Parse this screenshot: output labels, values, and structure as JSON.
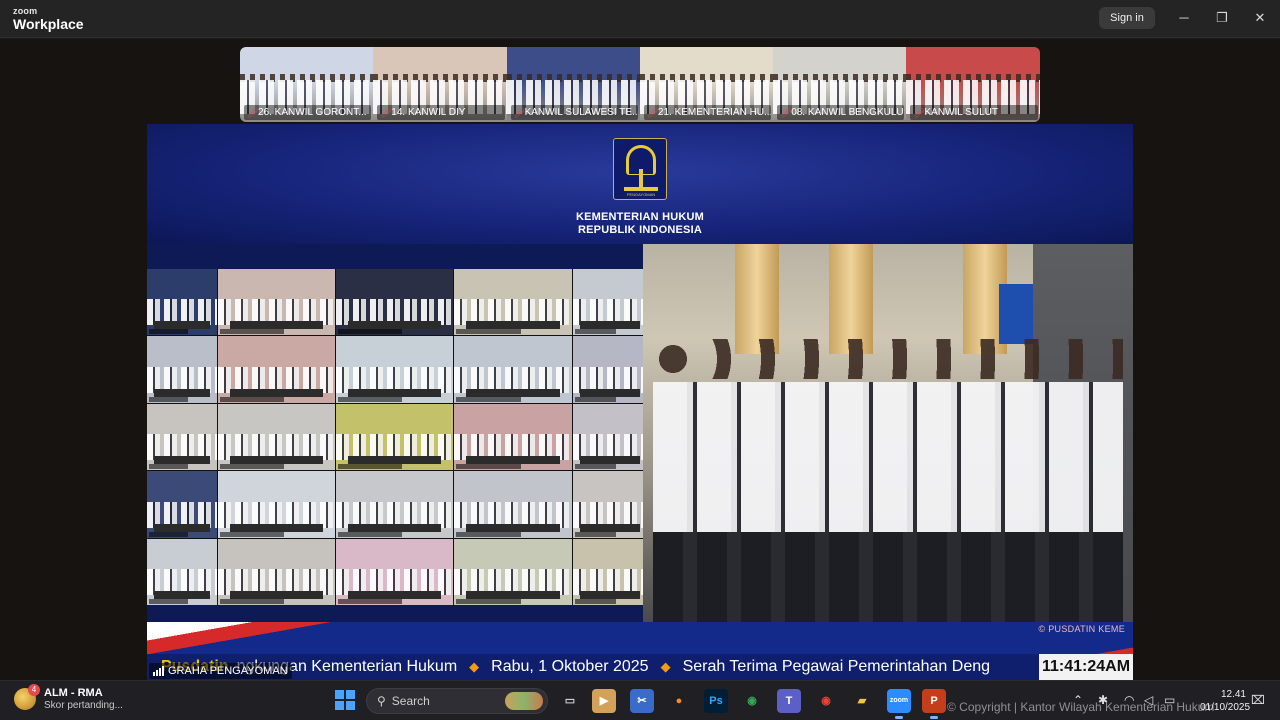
{
  "app": {
    "brand_top": "zoom",
    "brand_bottom": "Workplace",
    "sign_in": "Sign in",
    "controls": {
      "minimize": "─",
      "restore": "❐",
      "close": "✕"
    }
  },
  "participants": [
    {
      "name": "26. KANWIL GORONT...",
      "bg": "#cfd7e6"
    },
    {
      "name": "14. KANWIL DIY",
      "bg": "#d9c6b8"
    },
    {
      "name": "KANWIL SULAWESI TE...",
      "bg": "#3d4d8a"
    },
    {
      "name": "21. KEMENTERIAN HU...",
      "bg": "#e3dccb"
    },
    {
      "name": "08. KANWIL BENGKULU",
      "bg": "#d4d2cc"
    },
    {
      "name": "KANWIL SULUT",
      "bg": "#c94a4a"
    }
  ],
  "share": {
    "logo_caption": "PENGAYOMAN",
    "org_line1": "KEMENTERIAN HUKUM",
    "org_line2": "REPUBLIK INDONESIA",
    "copyright_overlay": "© PUSDATIN KEME",
    "ticker_fragment": "Pusdatin",
    "ticker_segments": [
      "ngkungan Kementerian Hukum",
      "Rabu, 1 Oktober 2025",
      "Serah Terima Pegawai Pemerintahan Deng"
    ],
    "ticker_clock": "11:41:24AM",
    "grid_colors": [
      "#2c3d6b",
      "#c9b7b0",
      "#2a2f45",
      "#c8c3b2",
      "#c5c9d0",
      "#b9bec9",
      "#caa9a4",
      "#c6d0d6",
      "#bfc6cf",
      "#b5b8c4",
      "#c7c4c0",
      "#c8c6c3",
      "#c3c26a",
      "#c9a3a3",
      "#c3c0c8",
      "#3c4a78",
      "#cfd5da",
      "#c6c8cc",
      "#c1c5cb",
      "#c7c4c2",
      "#c8ccd3",
      "#c6c3be",
      "#d9b9c7",
      "#c6c9b6",
      "#c8c2ad"
    ]
  },
  "speaker": {
    "name": "GRAHA PENGAYOMAN"
  },
  "taskbar": {
    "news_badge": "4",
    "news_title": "ALM - RMA",
    "news_subtitle": "Skor pertanding...",
    "search_placeholder": "Search",
    "apps": [
      {
        "name": "task-view-icon",
        "glyph": "▭",
        "color": "#d0d0d0",
        "bg": "transparent"
      },
      {
        "name": "media-player-icon",
        "glyph": "▶",
        "color": "#ffffff",
        "bg": "#d2a25a"
      },
      {
        "name": "snipping-tool-icon",
        "glyph": "✂",
        "color": "#ffffff",
        "bg": "#3a6bc9"
      },
      {
        "name": "firefox-icon",
        "glyph": "●",
        "color": "#ff8a1f",
        "bg": "transparent"
      },
      {
        "name": "photoshop-icon",
        "glyph": "Ps",
        "color": "#31a8ff",
        "bg": "#001e36"
      },
      {
        "name": "chrome-profile-icon",
        "glyph": "◉",
        "color": "#34a853",
        "bg": "transparent"
      },
      {
        "name": "teams-icon",
        "glyph": "T",
        "color": "#ffffff",
        "bg": "#5b5fc7"
      },
      {
        "name": "chrome-icon",
        "glyph": "◉",
        "color": "#ea4335",
        "bg": "transparent"
      },
      {
        "name": "file-explorer-icon",
        "glyph": "▰",
        "color": "#f4c542",
        "bg": "transparent"
      },
      {
        "name": "zoom-icon",
        "glyph": "zoom",
        "color": "#ffffff",
        "bg": "#2d8cff"
      },
      {
        "name": "powerpoint-icon",
        "glyph": "P",
        "color": "#ffffff",
        "bg": "#c43e1c"
      }
    ],
    "copyright": "© Copyright | Kantor Wilayah Kementerian Hukum",
    "time": "12.41",
    "date": "01/10/2025"
  }
}
